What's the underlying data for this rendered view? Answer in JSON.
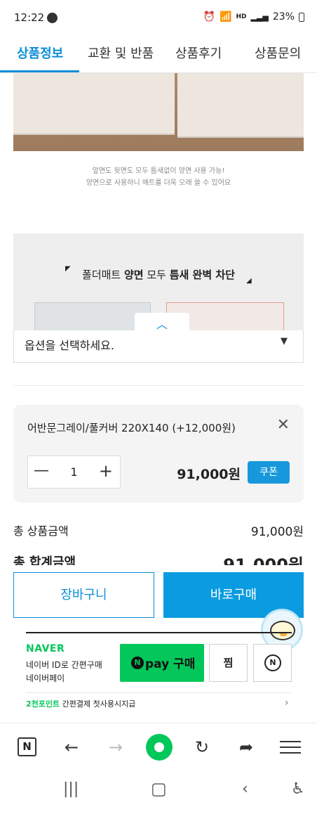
{
  "status_bar": {
    "time": "12:22",
    "net_badge": "HD",
    "battery": "23%"
  },
  "tabs": [
    {
      "label": "상품정보",
      "active": true
    },
    {
      "label": "교환 및 반품",
      "active": false
    },
    {
      "label": "상품후기",
      "active": false
    },
    {
      "label": "상품문의",
      "active": false
    }
  ],
  "image_caption": {
    "line1": "앞면도 뒷면도 모두 틈새없이 양면 사용 가능!",
    "line2": "양면으로 사용하니 매트를 더욱 오래 쓸 수 있어요"
  },
  "feature": {
    "title_pre": "폴더매트 ",
    "title_b1": "양면",
    "title_mid": " 모두 ",
    "title_b2": "틈새 완벽 차단"
  },
  "option_select": {
    "placeholder": "옵션을 선택하세요."
  },
  "selected_option": {
    "name": "어반문그레이/풀커버 220X140 (+12,000원)",
    "quantity": "1",
    "price": "91,000원",
    "coupon_label": "쿠폰"
  },
  "totals": {
    "product_total_label": "총 상품금액",
    "product_total_value": "91,000원",
    "grand_total_label": "총 합계금액",
    "grand_total_value": "91,000원"
  },
  "actions": {
    "cart_label": "장바구니",
    "buy_label": "바로구매"
  },
  "naver_pay": {
    "brand": "NAVER",
    "line1": "네이버 ID로 간편구매",
    "line2": "네이버페이",
    "pay_label": "pay 구매",
    "zzim_label": "찜",
    "point_green": "2천포인트",
    "point_text": " 간편결제 첫사용시지급"
  },
  "colors": {
    "accent": "#0b8fd8",
    "naver_green": "#03c75a"
  }
}
